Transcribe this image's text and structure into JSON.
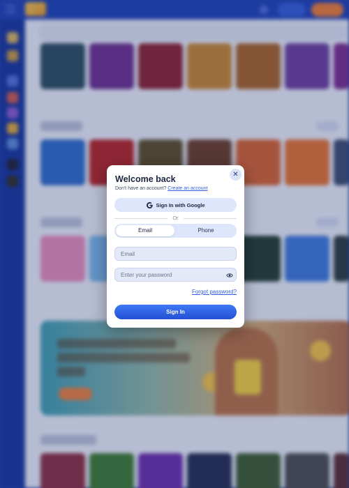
{
  "modal": {
    "title": "Welcome back",
    "subtitle_prefix": "Don't have an account?",
    "create_account_link": "Create an account",
    "google_button": "Sign In with Google",
    "or_label": "Or",
    "tabs": [
      {
        "label": "Email",
        "active": true
      },
      {
        "label": "Phone",
        "active": false
      }
    ],
    "email_placeholder": "Email",
    "password_placeholder": "Enter your password",
    "forgot_password": "Forgot password?",
    "sign_in_button": "Sign In",
    "close_glyph": "✕"
  },
  "colors": {
    "primary_blue": "#2f5fe0",
    "topbar": "#1a3fb5",
    "register_orange": "#f07b2e"
  }
}
